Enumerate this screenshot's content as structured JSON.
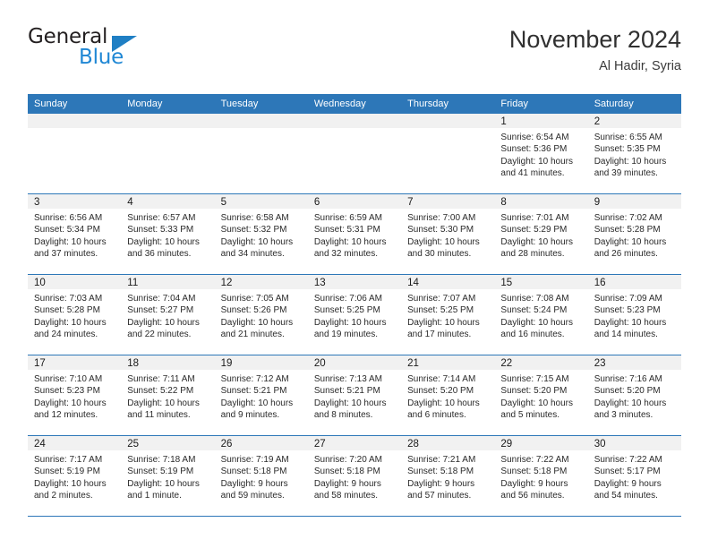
{
  "brand": {
    "name_dark": "General",
    "name_blue": "Blue",
    "accent_color": "#2d77b8",
    "logo_blue": "#1f87d4"
  },
  "header": {
    "title": "November 2024",
    "location": "Al Hadir, Syria"
  },
  "weekdays": [
    "Sunday",
    "Monday",
    "Tuesday",
    "Wednesday",
    "Thursday",
    "Friday",
    "Saturday"
  ],
  "weeks": [
    [
      {
        "day": "",
        "sunrise": "",
        "sunset": "",
        "daylight": "",
        "daylight2": ""
      },
      {
        "day": "",
        "sunrise": "",
        "sunset": "",
        "daylight": "",
        "daylight2": ""
      },
      {
        "day": "",
        "sunrise": "",
        "sunset": "",
        "daylight": "",
        "daylight2": ""
      },
      {
        "day": "",
        "sunrise": "",
        "sunset": "",
        "daylight": "",
        "daylight2": ""
      },
      {
        "day": "",
        "sunrise": "",
        "sunset": "",
        "daylight": "",
        "daylight2": ""
      },
      {
        "day": "1",
        "sunrise": "Sunrise: 6:54 AM",
        "sunset": "Sunset: 5:36 PM",
        "daylight": "Daylight: 10 hours",
        "daylight2": "and 41 minutes."
      },
      {
        "day": "2",
        "sunrise": "Sunrise: 6:55 AM",
        "sunset": "Sunset: 5:35 PM",
        "daylight": "Daylight: 10 hours",
        "daylight2": "and 39 minutes."
      }
    ],
    [
      {
        "day": "3",
        "sunrise": "Sunrise: 6:56 AM",
        "sunset": "Sunset: 5:34 PM",
        "daylight": "Daylight: 10 hours",
        "daylight2": "and 37 minutes."
      },
      {
        "day": "4",
        "sunrise": "Sunrise: 6:57 AM",
        "sunset": "Sunset: 5:33 PM",
        "daylight": "Daylight: 10 hours",
        "daylight2": "and 36 minutes."
      },
      {
        "day": "5",
        "sunrise": "Sunrise: 6:58 AM",
        "sunset": "Sunset: 5:32 PM",
        "daylight": "Daylight: 10 hours",
        "daylight2": "and 34 minutes."
      },
      {
        "day": "6",
        "sunrise": "Sunrise: 6:59 AM",
        "sunset": "Sunset: 5:31 PM",
        "daylight": "Daylight: 10 hours",
        "daylight2": "and 32 minutes."
      },
      {
        "day": "7",
        "sunrise": "Sunrise: 7:00 AM",
        "sunset": "Sunset: 5:30 PM",
        "daylight": "Daylight: 10 hours",
        "daylight2": "and 30 minutes."
      },
      {
        "day": "8",
        "sunrise": "Sunrise: 7:01 AM",
        "sunset": "Sunset: 5:29 PM",
        "daylight": "Daylight: 10 hours",
        "daylight2": "and 28 minutes."
      },
      {
        "day": "9",
        "sunrise": "Sunrise: 7:02 AM",
        "sunset": "Sunset: 5:28 PM",
        "daylight": "Daylight: 10 hours",
        "daylight2": "and 26 minutes."
      }
    ],
    [
      {
        "day": "10",
        "sunrise": "Sunrise: 7:03 AM",
        "sunset": "Sunset: 5:28 PM",
        "daylight": "Daylight: 10 hours",
        "daylight2": "and 24 minutes."
      },
      {
        "day": "11",
        "sunrise": "Sunrise: 7:04 AM",
        "sunset": "Sunset: 5:27 PM",
        "daylight": "Daylight: 10 hours",
        "daylight2": "and 22 minutes."
      },
      {
        "day": "12",
        "sunrise": "Sunrise: 7:05 AM",
        "sunset": "Sunset: 5:26 PM",
        "daylight": "Daylight: 10 hours",
        "daylight2": "and 21 minutes."
      },
      {
        "day": "13",
        "sunrise": "Sunrise: 7:06 AM",
        "sunset": "Sunset: 5:25 PM",
        "daylight": "Daylight: 10 hours",
        "daylight2": "and 19 minutes."
      },
      {
        "day": "14",
        "sunrise": "Sunrise: 7:07 AM",
        "sunset": "Sunset: 5:25 PM",
        "daylight": "Daylight: 10 hours",
        "daylight2": "and 17 minutes."
      },
      {
        "day": "15",
        "sunrise": "Sunrise: 7:08 AM",
        "sunset": "Sunset: 5:24 PM",
        "daylight": "Daylight: 10 hours",
        "daylight2": "and 16 minutes."
      },
      {
        "day": "16",
        "sunrise": "Sunrise: 7:09 AM",
        "sunset": "Sunset: 5:23 PM",
        "daylight": "Daylight: 10 hours",
        "daylight2": "and 14 minutes."
      }
    ],
    [
      {
        "day": "17",
        "sunrise": "Sunrise: 7:10 AM",
        "sunset": "Sunset: 5:23 PM",
        "daylight": "Daylight: 10 hours",
        "daylight2": "and 12 minutes."
      },
      {
        "day": "18",
        "sunrise": "Sunrise: 7:11 AM",
        "sunset": "Sunset: 5:22 PM",
        "daylight": "Daylight: 10 hours",
        "daylight2": "and 11 minutes."
      },
      {
        "day": "19",
        "sunrise": "Sunrise: 7:12 AM",
        "sunset": "Sunset: 5:21 PM",
        "daylight": "Daylight: 10 hours",
        "daylight2": "and 9 minutes."
      },
      {
        "day": "20",
        "sunrise": "Sunrise: 7:13 AM",
        "sunset": "Sunset: 5:21 PM",
        "daylight": "Daylight: 10 hours",
        "daylight2": "and 8 minutes."
      },
      {
        "day": "21",
        "sunrise": "Sunrise: 7:14 AM",
        "sunset": "Sunset: 5:20 PM",
        "daylight": "Daylight: 10 hours",
        "daylight2": "and 6 minutes."
      },
      {
        "day": "22",
        "sunrise": "Sunrise: 7:15 AM",
        "sunset": "Sunset: 5:20 PM",
        "daylight": "Daylight: 10 hours",
        "daylight2": "and 5 minutes."
      },
      {
        "day": "23",
        "sunrise": "Sunrise: 7:16 AM",
        "sunset": "Sunset: 5:20 PM",
        "daylight": "Daylight: 10 hours",
        "daylight2": "and 3 minutes."
      }
    ],
    [
      {
        "day": "24",
        "sunrise": "Sunrise: 7:17 AM",
        "sunset": "Sunset: 5:19 PM",
        "daylight": "Daylight: 10 hours",
        "daylight2": "and 2 minutes."
      },
      {
        "day": "25",
        "sunrise": "Sunrise: 7:18 AM",
        "sunset": "Sunset: 5:19 PM",
        "daylight": "Daylight: 10 hours",
        "daylight2": "and 1 minute."
      },
      {
        "day": "26",
        "sunrise": "Sunrise: 7:19 AM",
        "sunset": "Sunset: 5:18 PM",
        "daylight": "Daylight: 9 hours",
        "daylight2": "and 59 minutes."
      },
      {
        "day": "27",
        "sunrise": "Sunrise: 7:20 AM",
        "sunset": "Sunset: 5:18 PM",
        "daylight": "Daylight: 9 hours",
        "daylight2": "and 58 minutes."
      },
      {
        "day": "28",
        "sunrise": "Sunrise: 7:21 AM",
        "sunset": "Sunset: 5:18 PM",
        "daylight": "Daylight: 9 hours",
        "daylight2": "and 57 minutes."
      },
      {
        "day": "29",
        "sunrise": "Sunrise: 7:22 AM",
        "sunset": "Sunset: 5:18 PM",
        "daylight": "Daylight: 9 hours",
        "daylight2": "and 56 minutes."
      },
      {
        "day": "30",
        "sunrise": "Sunrise: 7:22 AM",
        "sunset": "Sunset: 5:17 PM",
        "daylight": "Daylight: 9 hours",
        "daylight2": "and 54 minutes."
      }
    ]
  ]
}
